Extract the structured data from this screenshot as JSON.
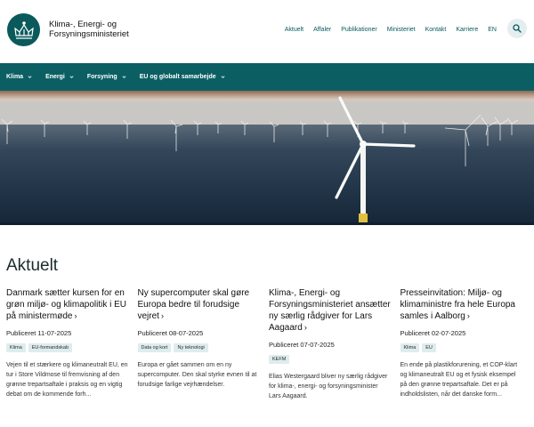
{
  "header": {
    "ministry_name_line1": "Klima-, Energi- og",
    "ministry_name_line2": "Forsyningsministeriet",
    "nav": [
      "Aktuelt",
      "Affaler",
      "Publikationer",
      "Ministeriet",
      "Kontakt",
      "Karriere",
      "EN"
    ],
    "search_icon": "search-icon"
  },
  "mainnav": {
    "items": [
      "Klima",
      "Energi",
      "Forsyning",
      "EU og globalt samarbejde"
    ]
  },
  "colors": {
    "brand": "#0b5f63",
    "tag_bg": "#dfeced"
  },
  "main": {
    "section_title": "Aktuelt",
    "cards": [
      {
        "title": "Danmark sætter kursen for en grøn miljø- og klimapolitik i EU på ministermøde",
        "date": "Publiceret 11-07-2025",
        "tags": [
          "Klima",
          "EU-formandskab"
        ],
        "text": "Vejen til et stærkere og klimaneutralt EU, en tur i Store Vildmose til fremvisning af den grønne trepartsaftale i praksis og en vigtig debat om de kommende forh..."
      },
      {
        "title": "Ny supercomputer skal gøre Europa bedre til forudsige vejret",
        "date": "Publiceret 08-07-2025",
        "tags": [
          "Data og kort",
          "Ny teknologi"
        ],
        "text": "Europa er gået sammen om en ny supercomputer. Den skal styrke evnen til at forudsige farlige vejrhændelser."
      },
      {
        "title": "Klima-, Energi- og Forsyningsministeriet ansætter ny særlig rådgiver for Lars Aagaard",
        "date": "Publiceret 07-07-2025",
        "tags": [
          "KEFM"
        ],
        "text": "Elias Westergaard bliver ny særlig rådgiver for klima-, energi- og forsyningsminister Lars Aagaard."
      },
      {
        "title": "Presseinvitation: Miljø- og klimaministre fra hele Europa samles i Aalborg",
        "date": "Publiceret 02-07-2025",
        "tags": [
          "Klima",
          "EU"
        ],
        "text": "En ende på plastikforurening, et COP-klart og klimaneutralt EU og et fysisk eksempel på den grønne trepartsaftale. Det er på indholdslisten, når det danske form..."
      }
    ]
  }
}
